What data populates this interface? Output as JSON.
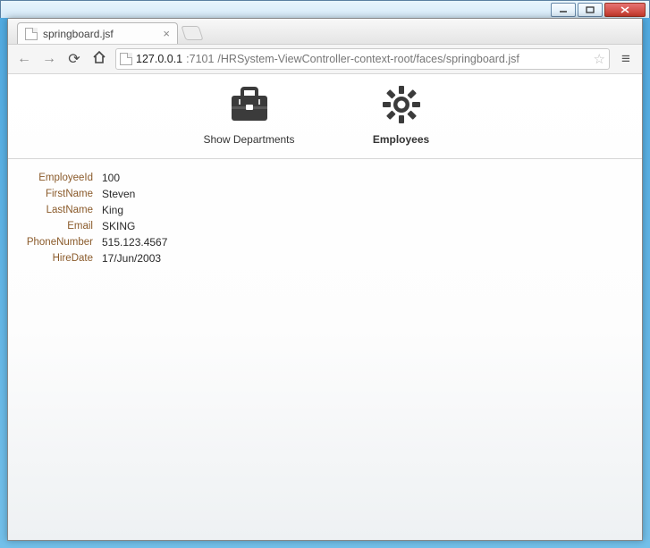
{
  "window": {
    "tab_title": "springboard.jsf",
    "url_host": "127.0.0.1",
    "url_port": ":7101",
    "url_path": "/HRSystem-ViewController-context-root/faces/springboard.jsf"
  },
  "springboard": {
    "departments": {
      "label": "Show Departments"
    },
    "employees": {
      "label": "Employees"
    }
  },
  "form": {
    "fields": [
      {
        "label": "EmployeeId",
        "value": "100"
      },
      {
        "label": "FirstName",
        "value": "Steven"
      },
      {
        "label": "LastName",
        "value": "King"
      },
      {
        "label": "Email",
        "value": "SKING"
      },
      {
        "label": "PhoneNumber",
        "value": "515.123.4567"
      },
      {
        "label": "HireDate",
        "value": "17/Jun/2003"
      }
    ]
  }
}
